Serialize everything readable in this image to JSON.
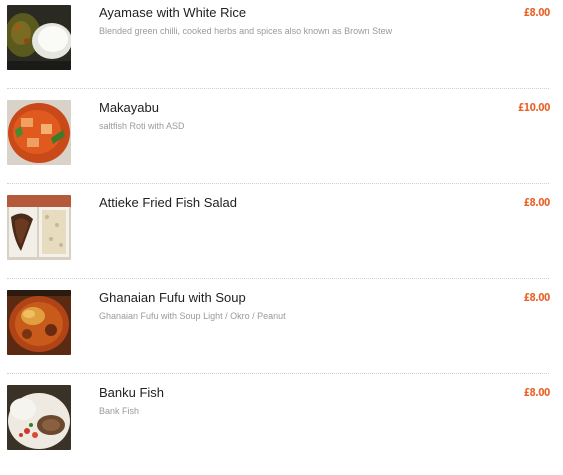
{
  "menu": {
    "items": [
      {
        "name": "Ayamase with White Rice",
        "description": "Blended green chilli, cooked herbs and spices also known as Brown Stew",
        "price": "£8.00",
        "image_icon": "ayamase-rice-photo"
      },
      {
        "name": "Makayabu",
        "description": "saltfish Roti with ASD",
        "price": "£10.00",
        "image_icon": "makayabu-stew-photo"
      },
      {
        "name": "Attieke Fried Fish Salad",
        "description": "",
        "price": "£8.00",
        "image_icon": "attieke-fish-photo"
      },
      {
        "name": "Ghanaian Fufu with Soup",
        "description": "Ghanaian Fufu with Soup Light / Okro / Peanut",
        "price": "£8.00",
        "image_icon": "fufu-soup-photo"
      },
      {
        "name": "Banku Fish",
        "description": "Bank Fish",
        "price": "£8.00",
        "image_icon": "banku-fish-photo"
      }
    ]
  },
  "colors": {
    "price": "#e8642c",
    "title": "#222222",
    "description": "#9a9a9a",
    "divider": "#cfcfcf"
  }
}
